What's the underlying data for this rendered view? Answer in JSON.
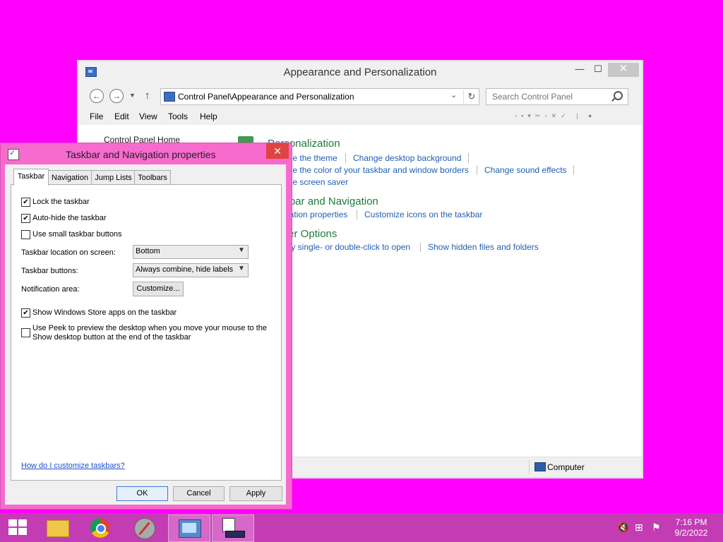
{
  "control_panel": {
    "title": "Appearance and Personalization",
    "address": "Control Panel\\Appearance and Personalization",
    "search_placeholder": "Search Control Panel",
    "menu": [
      "File",
      "Edit",
      "View",
      "Tools",
      "Help"
    ],
    "home_link": "Control Panel Home",
    "categories": [
      {
        "heading": "Personalization",
        "links_row1": [
          "Change the theme",
          "Change desktop background"
        ],
        "links_row2": [
          "Change the color of your taskbar and window borders",
          "Change sound effects"
        ],
        "links_row3": [
          "Change screen saver"
        ]
      },
      {
        "heading": "Taskbar and Navigation",
        "links_row1": [
          "Navigation properties",
          "Customize icons on the taskbar"
        ]
      },
      {
        "heading": "Folder Options",
        "links_row1": [
          "Specify single- or double-click to open",
          "Show hidden files and folders"
        ]
      }
    ],
    "status": "Computer"
  },
  "dialog": {
    "title": "Taskbar and Navigation properties",
    "tabs": [
      "Taskbar",
      "Navigation",
      "Jump Lists",
      "Toolbars"
    ],
    "options": {
      "lock": {
        "label": "Lock the taskbar",
        "checked": true
      },
      "autohide": {
        "label": "Auto-hide the taskbar",
        "checked": true
      },
      "small": {
        "label": "Use small taskbar buttons",
        "checked": false
      },
      "store": {
        "label": "Show Windows Store apps on the taskbar",
        "checked": true
      },
      "peek": {
        "label_line1": "Use Peek to preview the desktop when you move your mouse to the",
        "label_line2": "Show desktop button at the end of the taskbar",
        "checked": false
      }
    },
    "location_label": "Taskbar location on screen:",
    "location_value": "Bottom",
    "buttons_label": "Taskbar buttons:",
    "buttons_value": "Always combine, hide labels",
    "notification_label": "Notification area:",
    "customize_button": "Customize...",
    "help_link": "How do I customize taskbars?",
    "ok": "OK",
    "cancel": "Cancel",
    "apply": "Apply"
  },
  "taskbar": {
    "time": "7:16 PM",
    "date": "9/2/2022"
  }
}
